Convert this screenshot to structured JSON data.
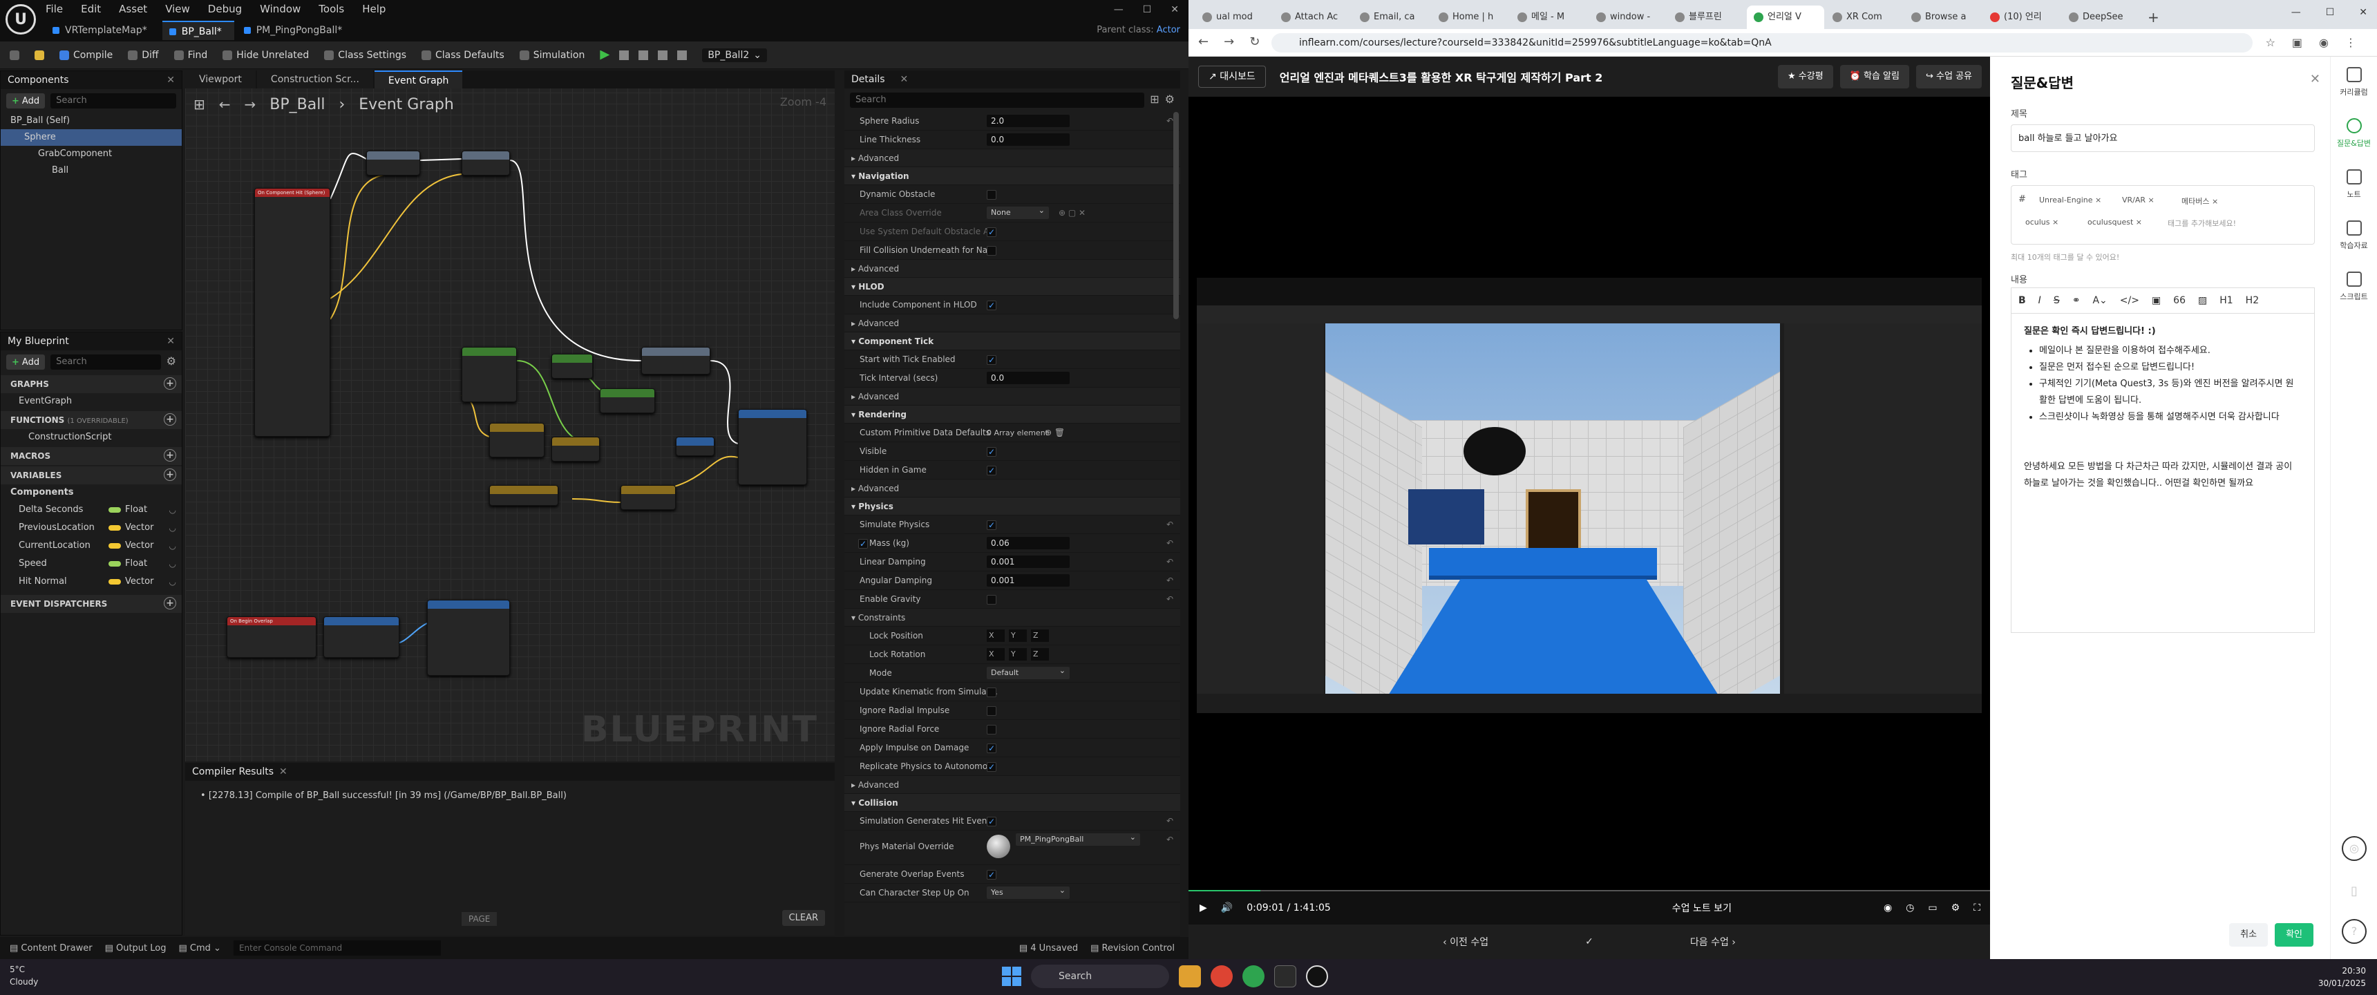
{
  "ue": {
    "menu": [
      "File",
      "Edit",
      "Asset",
      "View",
      "Debug",
      "Window",
      "Tools",
      "Help"
    ],
    "doc_tabs": [
      "VRTemplateMap*",
      "BP_Ball*",
      "PM_PingPongBall*"
    ],
    "parent_class_label": "Parent class:",
    "parent_class": "Actor",
    "toolbar": [
      "Compile",
      "Diff",
      "Find",
      "Hide Unrelated",
      "Class Settings",
      "Class Defaults",
      "Simulation"
    ],
    "debug_target": "BP_Ball2",
    "components": {
      "title": "Components",
      "add": "Add",
      "search": "Search",
      "tree": [
        "BP_Ball (Self)",
        "Sphere",
        "GrabComponent",
        "Ball"
      ]
    },
    "myblueprint": {
      "title": "My Blueprint",
      "add": "Add",
      "search": "Search",
      "graphs": "GRAPHS",
      "graph_items": [
        "EventGraph"
      ],
      "functions": "FUNCTIONS",
      "functions_count": "(1 OVERRIDABLE)",
      "function_items": [
        "ConstructionScript"
      ],
      "macros": "MACROS",
      "variables": "VARIABLES",
      "var_category": "Components",
      "vars": [
        {
          "name": "Delta Seconds",
          "type": "Float",
          "color": "#9bd35c"
        },
        {
          "name": "PreviousLocation",
          "type": "Vector",
          "color": "#f3c832"
        },
        {
          "name": "CurrentLocation",
          "type": "Vector",
          "color": "#f3c832"
        },
        {
          "name": "Speed",
          "type": "Float",
          "color": "#9bd35c"
        },
        {
          "name": "Hit Normal",
          "type": "Vector",
          "color": "#f3c832"
        }
      ],
      "dispatchers": "EVENT DISPATCHERS"
    },
    "graph": {
      "tabs": [
        "Viewport",
        "Construction Scr...",
        "Event Graph"
      ],
      "crumb_root": "BP_Ball",
      "crumb_leaf": "Event Graph",
      "zoom": "Zoom -4",
      "watermark": "BLUEPRINT",
      "node1": "On Component Hit (Sphere)",
      "node2": "On Begin Overlap"
    },
    "compiler": {
      "title": "Compiler Results",
      "message": "[2278.13] Compile of BP_Ball successful! [in 39 ms] (/Game/BP/BP_Ball.BP_Ball)",
      "page": "PAGE",
      "clear": "CLEAR"
    },
    "details": {
      "title": "Details",
      "search": "Search",
      "sphere_radius_label": "Sphere Radius",
      "sphere_radius": "2.0",
      "line_thickness_label": "Line Thickness",
      "line_thickness": "0.0",
      "advanced": "Advanced",
      "navigation": "Navigation",
      "dynamic_obstacle": "Dynamic Obstacle",
      "area_class_override": "Area Class Override",
      "area_class_value": "None",
      "use_system_default": "Use System Default Obstacle A...",
      "fill_collision": "Fill Collision Underneath for Na...",
      "hlod": "HLOD",
      "include_hlod": "Include Component in HLOD",
      "component_tick": "Component Tick",
      "start_tick": "Start with Tick Enabled",
      "tick_interval_label": "Tick Interval (secs)",
      "tick_interval": "0.0",
      "rendering": "Rendering",
      "custom_primitive": "Custom Primitive Data Defaults",
      "custom_primitive_value": "0 Array element",
      "visible": "Visible",
      "hidden_in_game": "Hidden in Game",
      "physics": "Physics",
      "simulate_physics": "Simulate Physics",
      "mass_label": "Mass (kg)",
      "mass": "0.06",
      "linear_damping_label": "Linear Damping",
      "linear_damping": "0.001",
      "angular_damping_label": "Angular Damping",
      "angular_damping": "0.001",
      "enable_gravity": "Enable Gravity",
      "constraints": "Constraints",
      "lock_position": "Lock Position",
      "lock_rotation": "Lock Rotation",
      "mode_label": "Mode",
      "mode_value": "Default",
      "axes": [
        "X",
        "Y",
        "Z"
      ],
      "update_kinematic": "Update Kinematic from Simulat...",
      "ignore_radial_impulse": "Ignore Radial Impulse",
      "ignore_radial_force": "Ignore Radial Force",
      "apply_impulse": "Apply Impulse on Damage",
      "replicate_physics": "Replicate Physics to Autonomo...",
      "collision": "Collision",
      "sim_hit_events": "Simulation Generates Hit Events",
      "phys_material_label": "Phys Material Override",
      "phys_material_value": "PM_PingPongBall",
      "gen_overlap": "Generate Overlap Events",
      "char_step_label": "Can Character Step Up On",
      "char_step_value": "Yes"
    },
    "status": {
      "content_drawer": "Content Drawer",
      "output_log": "Output Log",
      "cmd": "Cmd",
      "console_placeholder": "Enter Console Command",
      "unsaved": "4 Unsaved",
      "revision": "Revision Control"
    }
  },
  "browser": {
    "tabs": [
      "ual mod",
      "Attach Ac",
      "Email, ca",
      "Home | h",
      "메일 - M",
      "window -",
      "블루프린",
      "언리얼 V",
      "XR Com",
      "Browse a",
      "(10) 언리",
      "DeepSee"
    ],
    "url": "inflearn.com/courses/lecture?courseId=333842&unitId=259976&subtitleLanguage=ko&tab=QnA",
    "dashboard": "대시보드",
    "lecture_title": "언리얼 엔진과 메타퀘스트3를 활용한 XR 탁구게임 제작하기 Part 2",
    "header_buttons": [
      "수강평",
      "학습 알림",
      "수업 공유"
    ],
    "video_time": "0:09:01 / 1:41:05",
    "progress": 0.09,
    "notes_btn": "수업 노트 보기",
    "prev": "이전 수업",
    "next": "다음 수업",
    "qa": {
      "title": "질문&답변",
      "title_label": "제목",
      "title_value": "ball 하늘로 들고 날아가요",
      "tag_label": "태그",
      "tags": [
        "Unreal-Engine",
        "VR/AR",
        "메타버스",
        "oculus",
        "oculusquest"
      ],
      "tag_placeholder": "태그를 추가해보세요!",
      "tag_hint": "최대 10개의 태그를 달 수 있어요!",
      "content_label": "내용",
      "notice_title": "질문은 확인 즉시 답변드립니다! :)",
      "notice_items": [
        "메일이나 본 질문란을 이용하여 접수해주세요.",
        "질문은 먼저 접수된 순으로 답변드립니다!",
        "구체적인 기기(Meta Quest3, 3s 등)와 엔진 버전을 알려주시면 원활한 답변에 도움이 됩니다.",
        "스크린샷이나 녹화영상 등을 통해 설명해주시면 더욱 감사합니다"
      ],
      "body": "안녕하세요 모든 방법을 다 차근차근 따라 갔지만, 시뮬레이션 결과 공이 하늘로 날아가는 것을 확인했습니다.. 어떤걸 확인하면 될까요",
      "cancel": "취소",
      "confirm": "확인"
    },
    "rail": [
      "커리큘럼",
      "질문&답변",
      "노트",
      "학습자료",
      "스크립트"
    ]
  },
  "taskbar": {
    "temp": "5°C",
    "weather": "Cloudy",
    "search": "Search",
    "time": "20:30",
    "date": "30/01/2025"
  }
}
